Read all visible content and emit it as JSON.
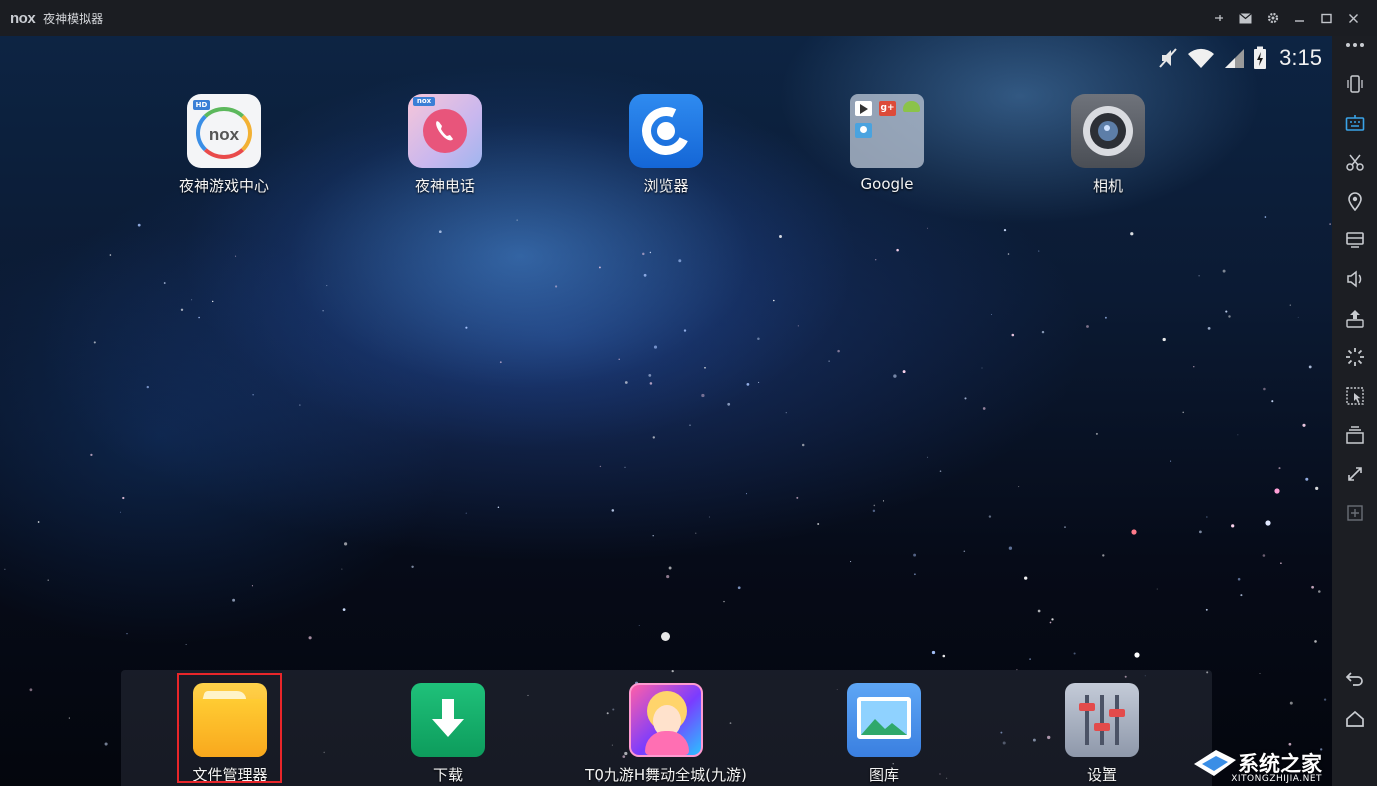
{
  "window": {
    "brand": "nox",
    "title": "夜神模拟器"
  },
  "statusbar": {
    "time": "3:15"
  },
  "home_apps": [
    {
      "label": "夜神游戏中心",
      "icon": "nox-game-center-icon"
    },
    {
      "label": "夜神电话",
      "icon": "phone-icon"
    },
    {
      "label": "浏览器",
      "icon": "browser-icon"
    },
    {
      "label": "Google",
      "icon": "google-folder-icon"
    },
    {
      "label": "相机",
      "icon": "camera-icon"
    }
  ],
  "dock_apps": [
    {
      "label": "文件管理器",
      "icon": "folder-icon"
    },
    {
      "label": "下载",
      "icon": "download-icon"
    },
    {
      "label": "T0九游H舞动全城(九游)",
      "icon": "game-icon"
    },
    {
      "label": "图库",
      "icon": "gallery-icon"
    },
    {
      "label": "设置",
      "icon": "settings-icon"
    }
  ],
  "watermark": {
    "text": "系统之家",
    "url_text": "XITONGZHIJIA.NET"
  },
  "colors": {
    "highlight": "#e8262a",
    "toolbar_active": "#3aa3e8"
  }
}
